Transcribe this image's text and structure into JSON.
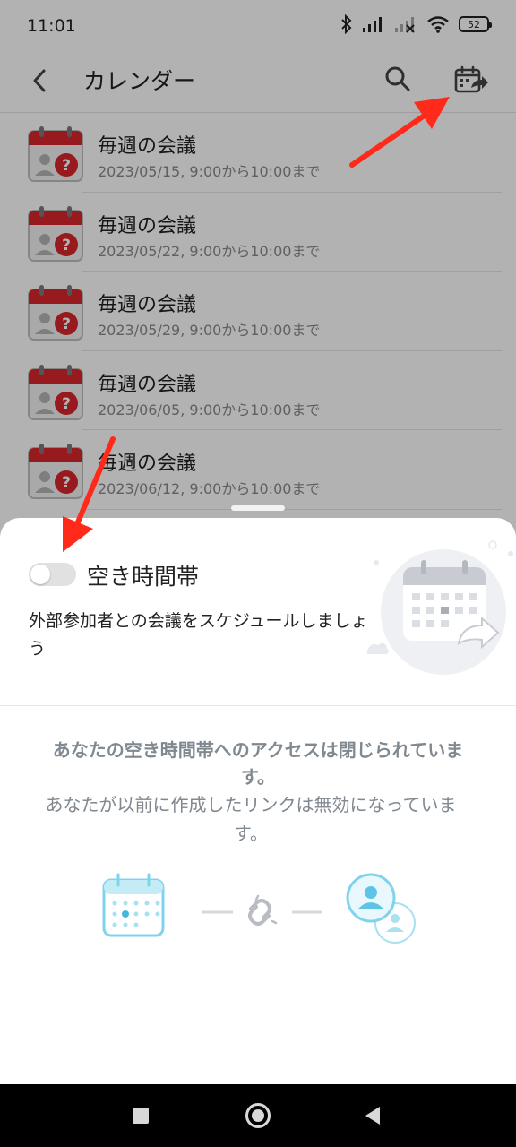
{
  "status_bar": {
    "time": "11:01",
    "battery": "52",
    "icons": [
      "bluetooth-icon",
      "signal-icon",
      "signal-off-icon",
      "wifi-icon",
      "battery-icon"
    ]
  },
  "app_bar": {
    "title": "カレンダー",
    "back_icon": "chevron-left-icon",
    "search_icon": "search-icon",
    "share_icon": "calendar-share-icon"
  },
  "events": [
    {
      "title": "毎週の会議",
      "time": "2023/05/15, 9:00から10:00まで"
    },
    {
      "title": "毎週の会議",
      "time": "2023/05/22, 9:00から10:00まで"
    },
    {
      "title": "毎週の会議",
      "time": "2023/05/29, 9:00から10:00まで"
    },
    {
      "title": "毎週の会議",
      "time": "2023/06/05, 9:00から10:00まで"
    },
    {
      "title": "毎週の会議",
      "time": "2023/06/12, 9:00から10:00まで"
    }
  ],
  "sheet": {
    "toggle_label": "空き時間帯",
    "toggle_on": false,
    "description": "外部参加者との会議をスケジュールしましょう",
    "closed_title": "あなたの空き時間帯へのアクセスは閉じられています。",
    "closed_desc": "あなたが以前に作成したリンクは無効になっています。"
  },
  "colors": {
    "accent_red": "#d9262b",
    "annotation_arrow": "#ff2a1a",
    "light_blue": "#7fd3ec",
    "muted_text": "#808890"
  }
}
